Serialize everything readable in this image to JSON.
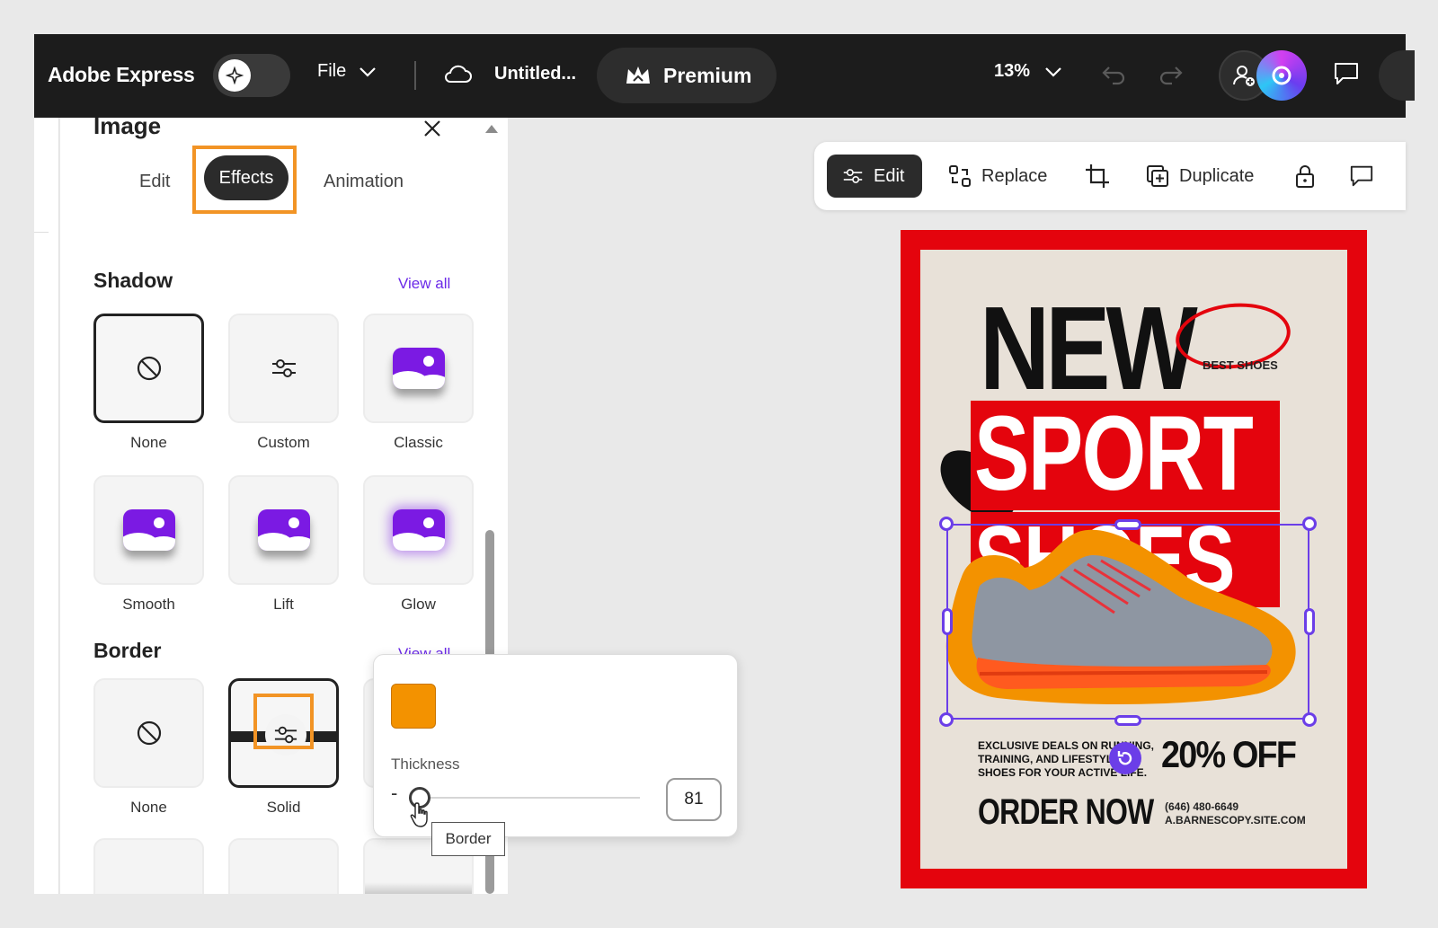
{
  "topbar": {
    "brand": "Adobe Express",
    "file_label": "File",
    "doc_title": "Untitled...",
    "premium_label": "Premium",
    "zoom": "13%"
  },
  "panel": {
    "title": "Image",
    "tabs": {
      "edit": "Edit",
      "effects": "Effects",
      "animation": "Animation"
    },
    "shadow": {
      "title": "Shadow",
      "view_all": "View all",
      "options": [
        "None",
        "Custom",
        "Classic",
        "Smooth",
        "Lift",
        "Glow"
      ]
    },
    "border": {
      "title": "Border",
      "view_all": "View all",
      "options": [
        "None",
        "Solid"
      ]
    }
  },
  "toolbar": {
    "edit": "Edit",
    "replace": "Replace",
    "duplicate": "Duplicate"
  },
  "popover": {
    "color": "#f39200",
    "thickness_label": "Thickness",
    "thickness_value": "81",
    "slider_level": 0.02
  },
  "tooltip": "Border",
  "poster": {
    "headline1": "NEW",
    "tag": "BEST SHOES",
    "headline2": "SPORT",
    "headline3": "SHOES",
    "deals": "EXCLUSIVE DEALS ON RUNNING, TRAINING, AND LIFESTYLE SHOES FOR YOUR ACTIVE LIFE.",
    "discount": "20% OFF",
    "cta": "ORDER NOW",
    "phone": "(646) 480-6649",
    "site": "A.BARNESCOPY.SITE.COM"
  },
  "colors": {
    "accent": "#6b2ae8",
    "highlight": "#f29425",
    "poster_red": "#e4040d"
  }
}
